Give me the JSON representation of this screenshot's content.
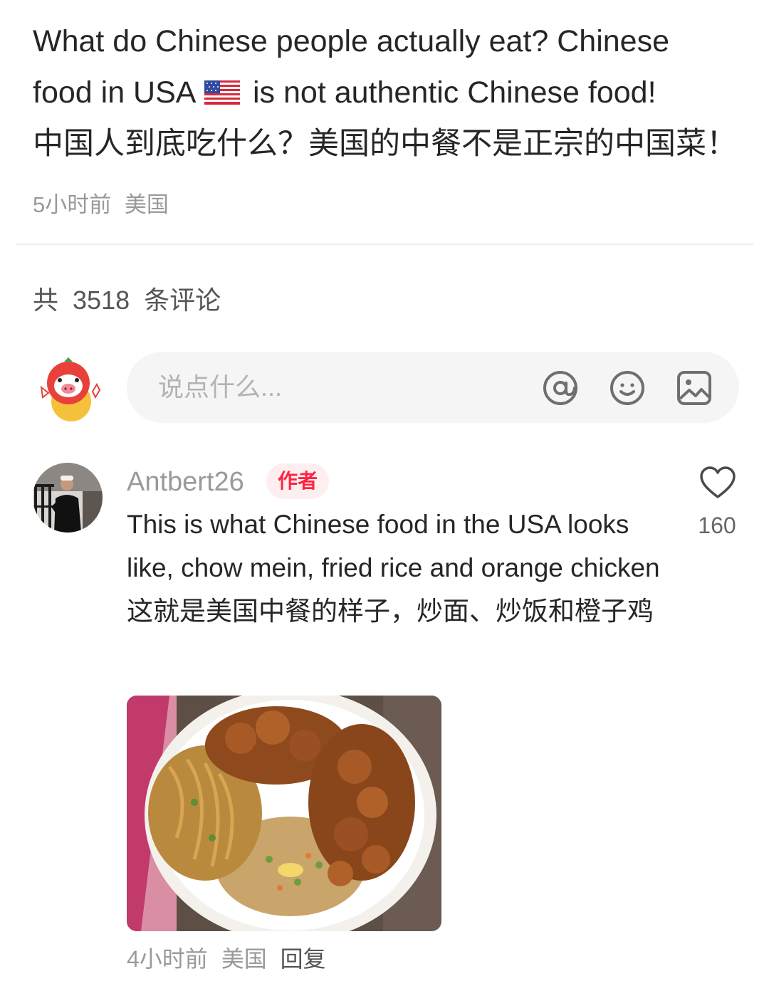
{
  "post": {
    "title_line1": "What do Chinese people actually eat? Chinese",
    "title_line2a": "food in USA",
    "title_line2b": "is not authentic Chinese food!",
    "title_line3": "中国人到底吃什么？美国的中餐不是正宗的中国菜！",
    "time": "5小时前",
    "location": "美国"
  },
  "comments_header": {
    "prefix": "共",
    "count": "3518",
    "suffix": "条评论"
  },
  "input": {
    "placeholder": "说点什么..."
  },
  "comment": {
    "username": "Antbert26",
    "author_tag": "作者",
    "likes": "160",
    "text": "This is what Chinese food in the USA looks like, chow mein, fried rice and orange chicken 这就是美国中餐的样子，炒面、炒饭和橙子鸡",
    "time": "4小时前",
    "location": "美国",
    "reply_label": "回复"
  },
  "colors": {
    "accent": "#ff2442",
    "muted": "#999999",
    "input_bg": "#f5f5f5"
  },
  "icons": [
    "flag-usa-icon",
    "at-icon",
    "emoji-icon",
    "image-icon",
    "heart-icon"
  ]
}
